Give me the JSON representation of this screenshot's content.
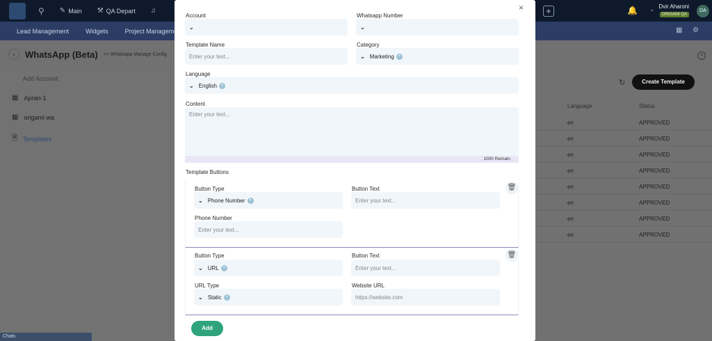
{
  "topbar": {
    "items": [
      "Main",
      "QA Depart"
    ],
    "user_name": "Dvir Aharoni",
    "user_badge": "ORIGAMI QA",
    "avatar_initials": "DA"
  },
  "navbar": {
    "items": [
      "Lead Management",
      "Widgets",
      "Project Management"
    ]
  },
  "page": {
    "title": "WhatsApp (Beta)",
    "breadcrumb": ">> Whatsapp Manage Config"
  },
  "sidebar": {
    "add_account": "Add Account",
    "items": [
      {
        "label": "Apran-1"
      },
      {
        "label": "origami wa"
      },
      {
        "label": "Templates"
      }
    ],
    "chats_label": "Chats"
  },
  "table": {
    "create_label": "Create Template",
    "headers": {
      "language": "Language",
      "status": "Status"
    },
    "rows": [
      {
        "language": "en",
        "status": "APPROVED"
      },
      {
        "language": "en",
        "status": "APPROVED"
      },
      {
        "language": "en",
        "status": "APPROVED"
      },
      {
        "language": "en",
        "status": "APPROVED"
      },
      {
        "language": "en",
        "status": "APPROVED"
      },
      {
        "language": "en",
        "status": "APPROVED"
      },
      {
        "language": "en",
        "status": "APPROVED"
      },
      {
        "language": "en",
        "status": "APPROVED"
      }
    ]
  },
  "modal": {
    "account_label": "Account",
    "whatsapp_number_label": "Whatsapp Number",
    "template_name_label": "Template Name",
    "template_name_placeholder": "Enter your text...",
    "category_label": "Category",
    "category_value": "Marketing",
    "language_label": "Language",
    "language_value": "English",
    "content_label": "Content",
    "content_placeholder": "Enter your text...",
    "content_remaining": "1000 Remain",
    "template_buttons_label": "Template Buttons",
    "buttons": [
      {
        "type_label": "Button Type",
        "type_value": "Phone Number",
        "text_label": "Button Text",
        "text_placeholder": "Enter your text...",
        "extra_label": "Phone Number",
        "extra_placeholder": "Enter your text..."
      },
      {
        "type_label": "Button Type",
        "type_value": "URL",
        "text_label": "Button Text",
        "text_placeholder": "Enter your text...",
        "url_type_label": "URL Type",
        "url_type_value": "Static",
        "website_label": "Website URL",
        "website_placeholder": "https://website.com"
      }
    ],
    "add_label": "Add"
  }
}
